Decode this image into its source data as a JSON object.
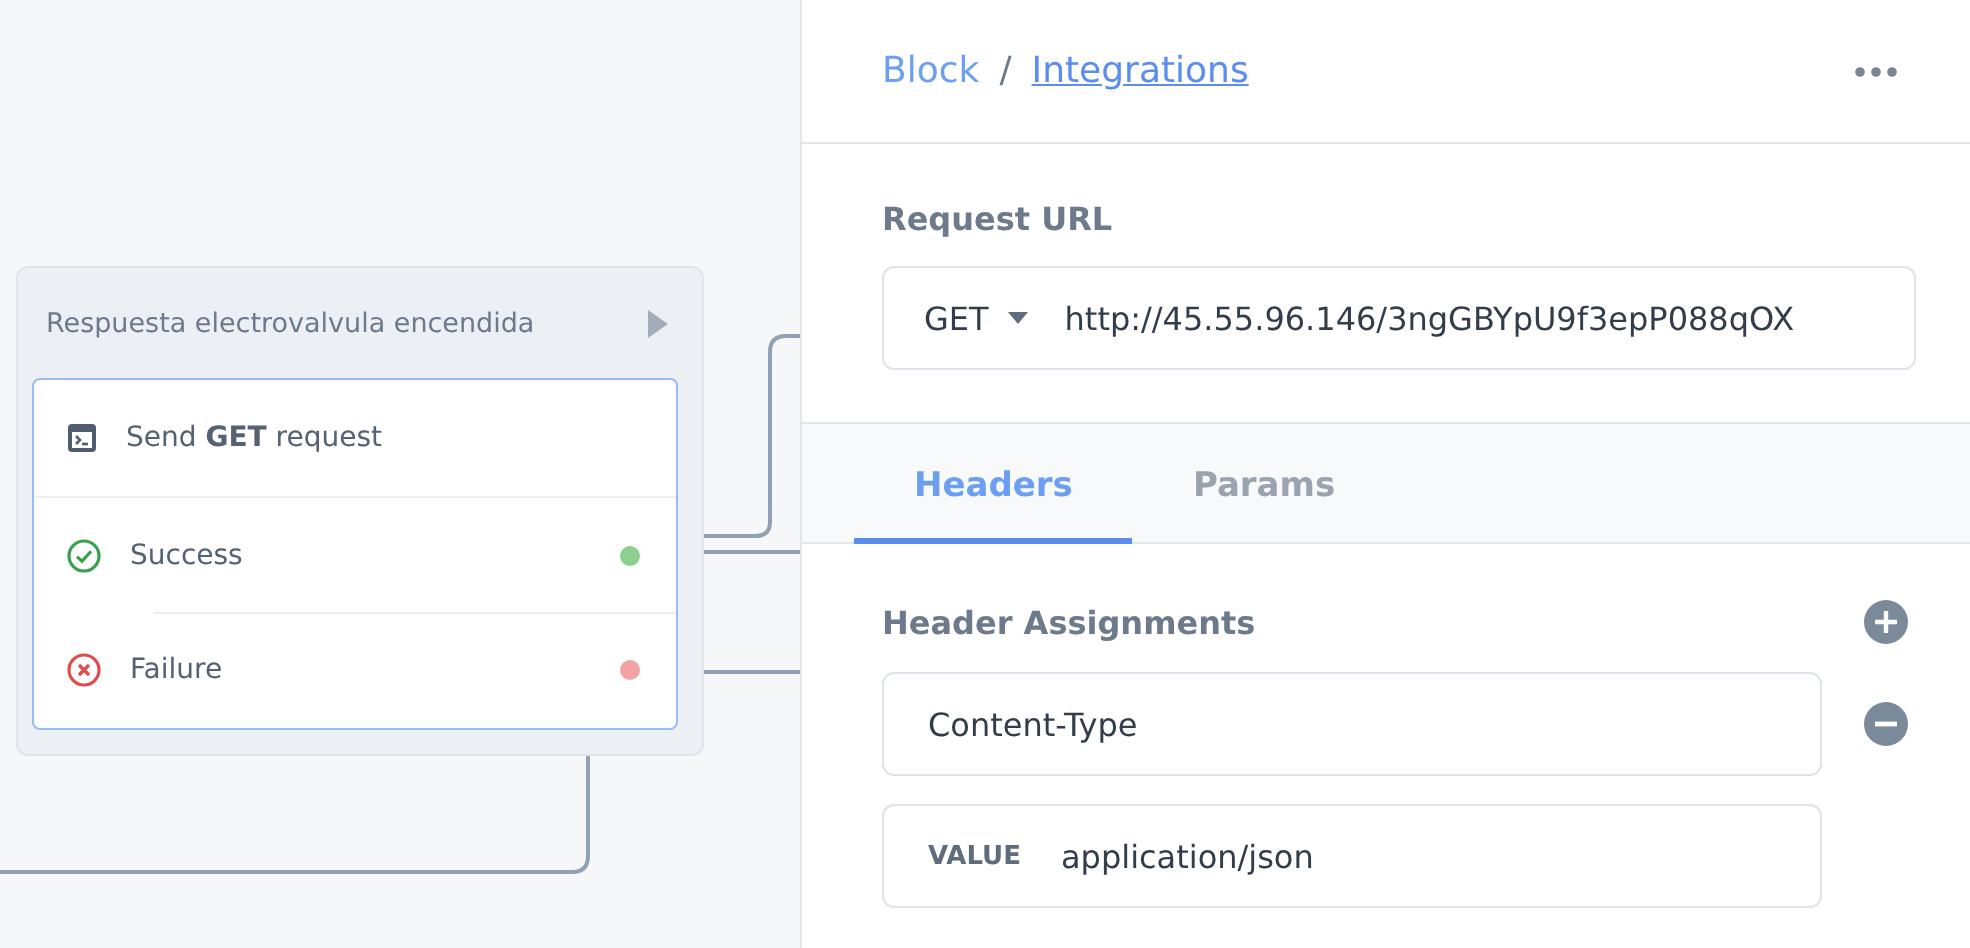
{
  "canvas": {
    "node": {
      "title": "Respuesta electrovalvula encendida",
      "rows": [
        {
          "kind": "action",
          "label": "Send **GET** request"
        },
        {
          "kind": "success",
          "label": "Success",
          "color": "#8ccf8e"
        },
        {
          "kind": "failure",
          "label": "Failure",
          "color": "#f3a3a3"
        }
      ]
    }
  },
  "panel": {
    "breadcrumb": [
      {
        "kind": "link",
        "label": "Block"
      },
      {
        "kind": "separator",
        "label": "/"
      },
      {
        "kind": "current",
        "label": "Integrations"
      }
    ],
    "request_url": {
      "label": "Request URL",
      "method": "GET",
      "value": "http://45.55.96.146/3ngGBYpU9f3epP088qOX"
    },
    "tabs": [
      {
        "label": "Headers",
        "selected": true
      },
      {
        "label": "Params",
        "selected": false
      }
    ],
    "headers": {
      "title": "Header Assignments",
      "assignments": [
        {
          "key": "Content-Type",
          "value_label": "VALUE",
          "value": "application/json"
        }
      ]
    }
  }
}
